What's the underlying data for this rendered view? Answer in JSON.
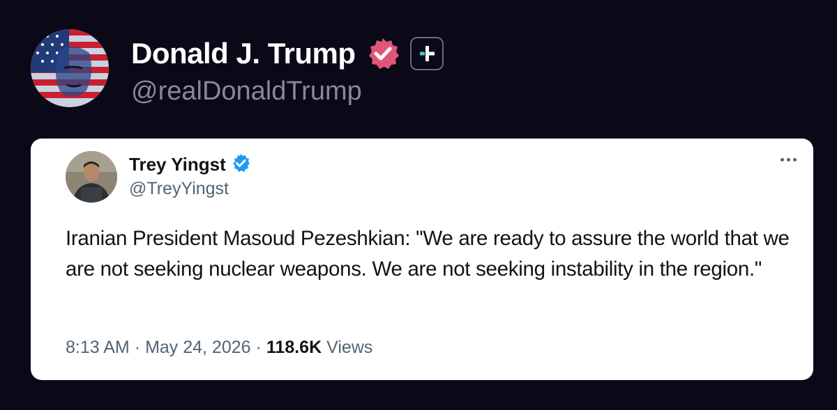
{
  "post": {
    "author_name": "Donald J. Trump",
    "author_handle": "@realDonaldTrump",
    "verified_badge_icon": "verified-badge-icon",
    "verified_badge_color": "#e0567a",
    "subscribe_icon": "plus-icon"
  },
  "quoted_tweet": {
    "author_name": "Trey Yingst",
    "author_handle": "@TreyYingst",
    "verified_badge_icon": "verified-badge-icon",
    "verified_badge_color": "#1d9bf0",
    "more_icon": "more-options-icon",
    "text": "Iranian President Masoud Pezeshkian: \"We are ready to assure the world that we are not seeking nuclear weapons. We are not seeking instability in the region.\"",
    "time": "8:13 AM",
    "separator": "·",
    "date": "May 24, 2026",
    "views_count": "118.6K",
    "views_label": "Views"
  },
  "colors": {
    "background": "#0b0818",
    "card_background": "#ffffff",
    "primary_text": "#0f1419",
    "secondary_text": "#536471"
  }
}
